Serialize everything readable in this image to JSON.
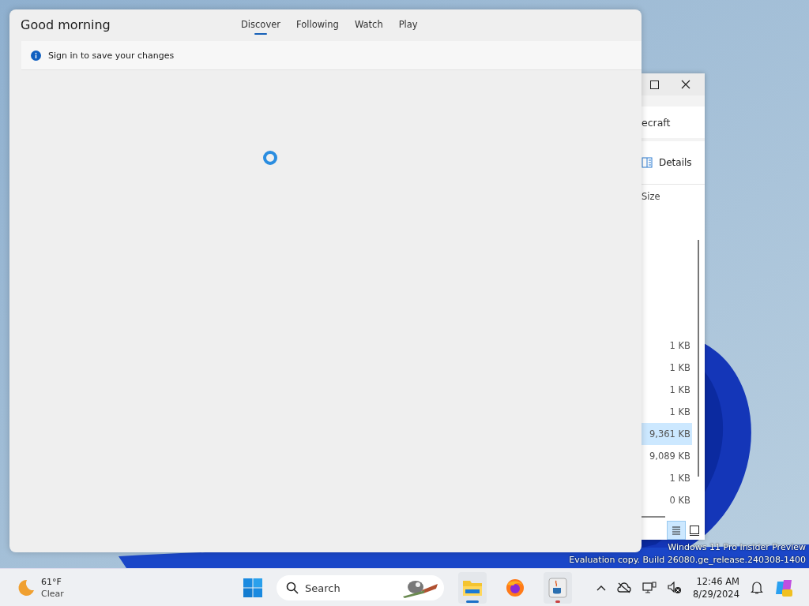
{
  "widgets_panel": {
    "greeting": "Good morning",
    "tabs": [
      {
        "label": "Discover",
        "selected": true
      },
      {
        "label": "Following",
        "selected": false
      },
      {
        "label": "Watch",
        "selected": false
      },
      {
        "label": "Play",
        "selected": false
      }
    ],
    "notice": "Sign in to save your changes"
  },
  "explorer_window": {
    "title_fragment": "ecraft",
    "toolbar_button": "Details",
    "column_header": "Size",
    "rows": [
      {
        "size": "1 KB",
        "selected": false
      },
      {
        "size": "1 KB",
        "selected": false
      },
      {
        "size": "1 KB",
        "selected": false
      },
      {
        "size": "1 KB",
        "selected": false
      },
      {
        "size": "9,361 KB",
        "selected": true
      },
      {
        "size": "9,089 KB",
        "selected": false
      },
      {
        "size": "1 KB",
        "selected": false
      },
      {
        "size": "0 KB",
        "selected": false
      }
    ]
  },
  "watermark": [
    "Windows 11 Pro Insider Preview",
    "Evaluation copy. Build 26080.ge_release.240308-1400"
  ],
  "taskbar": {
    "temperature": "61°F",
    "condition": "Clear",
    "search": {
      "placeholder": "Search"
    },
    "apps": [
      {
        "kind": "explorer",
        "active": true
      },
      {
        "kind": "firefox",
        "active": false
      },
      {
        "kind": "java",
        "active": true
      }
    ],
    "time": "12:46 AM",
    "date": "8/29/2024"
  }
}
